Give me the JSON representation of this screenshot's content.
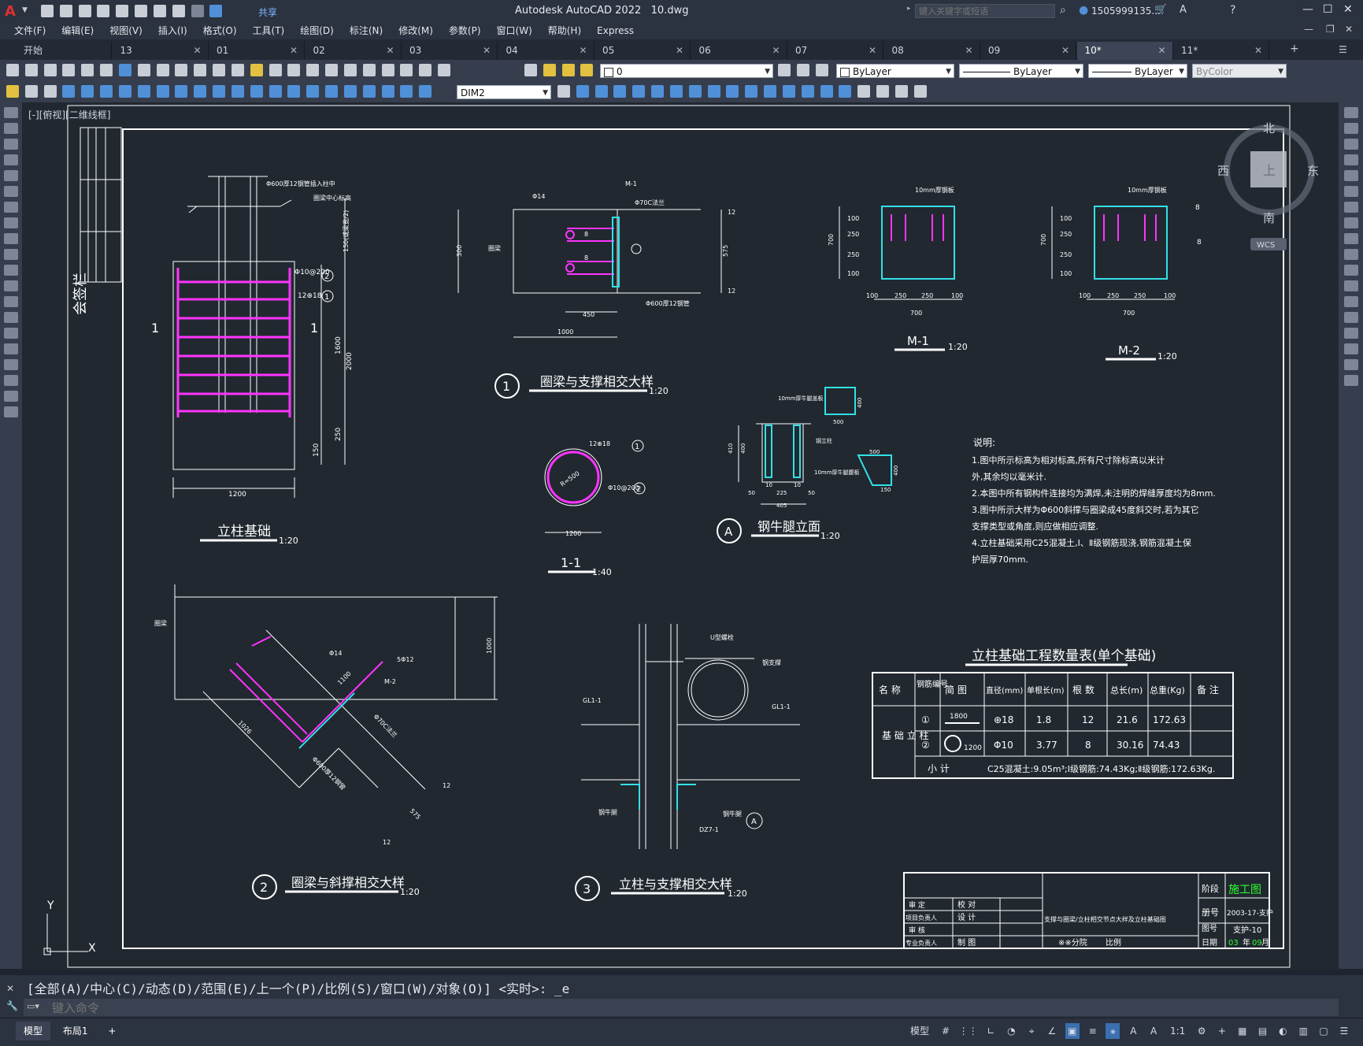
{
  "app": {
    "title": "Autodesk AutoCAD 2022",
    "filename": "10.dwg",
    "share_label": "共享",
    "search_placeholder": "键入关键字或短语",
    "user": "1505999135...",
    "window_min": "—",
    "window_max": "☐",
    "window_close": "✕"
  },
  "menus": [
    "文件(F)",
    "编辑(E)",
    "视图(V)",
    "插入(I)",
    "格式(O)",
    "工具(T)",
    "绘图(D)",
    "标注(N)",
    "修改(M)",
    "参数(P)",
    "窗口(W)",
    "帮助(H)",
    "Express"
  ],
  "tabs": [
    "开始",
    "13",
    "01",
    "02",
    "03",
    "04",
    "05",
    "06",
    "07",
    "08",
    "09",
    "10*",
    "11*"
  ],
  "tab_add": "+",
  "layer_value": "0",
  "props": {
    "color": "ByLayer",
    "linetype": "ByLayer",
    "lineweight": "ByLayer",
    "plotstyle": "ByColor"
  },
  "dimstyle": "DIM2",
  "viewport_label": "[-][俯视][二维线框]",
  "viewcube": {
    "north": "北",
    "south": "南",
    "east": "东",
    "west": "西",
    "top": "上",
    "wcs": "WCS"
  },
  "drawing": {
    "countersign": "会签栏",
    "col_title": "立柱基础",
    "col_scale": "1:20",
    "sec_mark": "1",
    "col_labels": {
      "top_note": "Φ600厚12钢管插入柱中",
      "beam_note": "圈梁中心标高",
      "stir1": "Φ10@200",
      "stir2": "12⊕18",
      "dim_width": "1200",
      "dim_h1": "2000",
      "dim_h2": "1600",
      "dim_h3": "250",
      "dim_h4": "150",
      "dim_note": "150(或梁宽/2)",
      "call1": "1",
      "call2": "2"
    },
    "d1": {
      "num": "1",
      "title": "圈梁与支撑相交大样",
      "scale": "1:20",
      "lbl_rebar": "Φ14",
      "lbl_m1": "M-1",
      "lbl_flange": "Φ70C法兰",
      "lbl_pipe": "Φ600厚12钢管",
      "lbl_beam": "圈梁",
      "dim_450": "450",
      "dim_1000": "1000",
      "dim_300": "300",
      "dim_575": "575",
      "dim_12a": "12",
      "dim_12b": "12",
      "lbl_8a": "8",
      "lbl_8b": "8"
    },
    "sec11": {
      "title": "1-1",
      "scale": "1:40",
      "lbl_r": "12⊕18",
      "lbl_s": "Φ10@200",
      "dim": "1200",
      "rad": "R=500",
      "c1": "1",
      "c2": "2"
    },
    "m1": {
      "title": "M-1",
      "scale": "1:20",
      "note": "10mm厚钢板",
      "dims": [
        "100",
        "250",
        "250",
        "100"
      ],
      "total": "700",
      "v_dims": [
        "100",
        "250",
        "250",
        "100"
      ],
      "v_total": "700"
    },
    "m2": {
      "title": "M-2",
      "scale": "1:20",
      "note": "10mm厚钢板",
      "dims": [
        "100",
        "250",
        "250",
        "100"
      ],
      "total": "700",
      "v_dims": [
        "100",
        "250",
        "250",
        "100"
      ],
      "v_total": "700",
      "w1": "8",
      "w2": "8"
    },
    "dA": {
      "num": "A",
      "title": "钢牛腿立面",
      "scale": "1:20",
      "lbl_top": "10mm厚牛腿盖板",
      "lbl_col": "钢立柱",
      "lbl_plate": "10mm厚牛腿腹板",
      "dims": [
        "10",
        "225",
        "10",
        "50",
        "50"
      ],
      "total": "405",
      "v1": "410",
      "v2": "400",
      "p1_w": "500",
      "p1_h": "400",
      "p2_w": "500",
      "p2_h": "400",
      "p2_b": "150"
    },
    "notes": {
      "title": "说明:",
      "lines": [
        "1.图中所示标高为相对标高,所有尺寸除标高以米计",
        "   外,其余均以毫米计.",
        "2.本图中所有钢构件连接均为满焊,未注明的焊缝厚度均为8mm.",
        "3.图中所示大样为Φ600斜撑与圈梁成45度斜交时,若为其它",
        "   支撑类型或角度,则应做相应调整.",
        "4.立柱基础采用C25混凝土,Ⅰ、Ⅱ级钢筋现浇,钢筋混凝土保",
        "   护层厚70mm."
      ]
    },
    "d2": {
      "num": "2",
      "title": "圈梁与斜撑相交大样",
      "scale": "1:20",
      "lbl_beam": "圈梁",
      "lbl_rebar": "Φ14",
      "lbl_m2": "M-2",
      "lbl_flange": "Φ70C法兰",
      "lbl_pipe": "Φ600厚12钢管",
      "lbl_5": "5Φ12",
      "dim_1000": "1000",
      "dim_1100": "1100",
      "dim_1026": "1026",
      "dim_575": "575",
      "dim_12a": "12",
      "dim_12b": "12"
    },
    "d3": {
      "num": "3",
      "title": "立柱与支撑相交大样",
      "scale": "1:20",
      "lbl_u": "U型螺栓",
      "lbl_steel": "钢支撑",
      "lbl_gl1a": "GL1-1",
      "lbl_gl1b": "GL1-1",
      "lbl_niutui": "钢牛腿",
      "lbl_plate": "钢牛腿",
      "lbl_dz": "DZ7-1",
      "lbl_a": "A"
    },
    "table": {
      "title": "立柱基础工程数量表(单个基础)",
      "headers": [
        "名 称",
        "钢筋编号",
        "简    图",
        "直径(mm)",
        "单根长(m)",
        "根 数",
        "总长(m)",
        "总重(Kg)",
        "备 注"
      ],
      "group": "基 础 立 柱",
      "rows": [
        [
          "①",
          "1800",
          "⊕18",
          "1.8",
          "12",
          "21.6",
          "172.63",
          ""
        ],
        [
          "②",
          "1200",
          "Φ10",
          "3.77",
          "8",
          "30.16",
          "74.43",
          ""
        ]
      ],
      "subtotal_label": "小    计",
      "subtotal": "C25混凝土:9.05m³;Ⅰ级钢筋:74.43Kg;Ⅱ级钢筋:172.63Kg."
    },
    "titleblock": {
      "stage_label": "阶段",
      "stage": "施工图",
      "r1": [
        "审  定",
        "校  对"
      ],
      "r2": [
        "项目负责人",
        "设  计"
      ],
      "r3": [
        "审  核",
        ""
      ],
      "r4": [
        "专业负责人",
        "制  图"
      ],
      "title": "支撑与圈梁/立柱相交节点大样及立柱基础图",
      "company": "※※分院",
      "ratio": "比例",
      "no_label": "册号",
      "no": "2003-17-支护",
      "drw_label": "图号",
      "drw": "支护-10",
      "date_label": "日期",
      "date_y": "03",
      "date_m": "09",
      "year": "年",
      "month": "月"
    },
    "ucs": {
      "x": "X",
      "y": "Y"
    }
  },
  "cmd": {
    "history": "[全部(A)/中心(C)/动态(D)/范围(E)/上一个(P)/比例(S)/窗口(W)/对象(O)] <实时>: _e",
    "placeholder": "键入命令"
  },
  "status": {
    "model_tab": "模型",
    "layout_tab": "布局1",
    "add": "+",
    "model": "模型",
    "scale": "1:1"
  },
  "colors": {
    "bg": "#212830",
    "line": "#ffffff",
    "rebar": "#ff33ff",
    "plate": "#33e0e6",
    "green": "#2cff2c",
    "accent": "#4f90d9"
  }
}
